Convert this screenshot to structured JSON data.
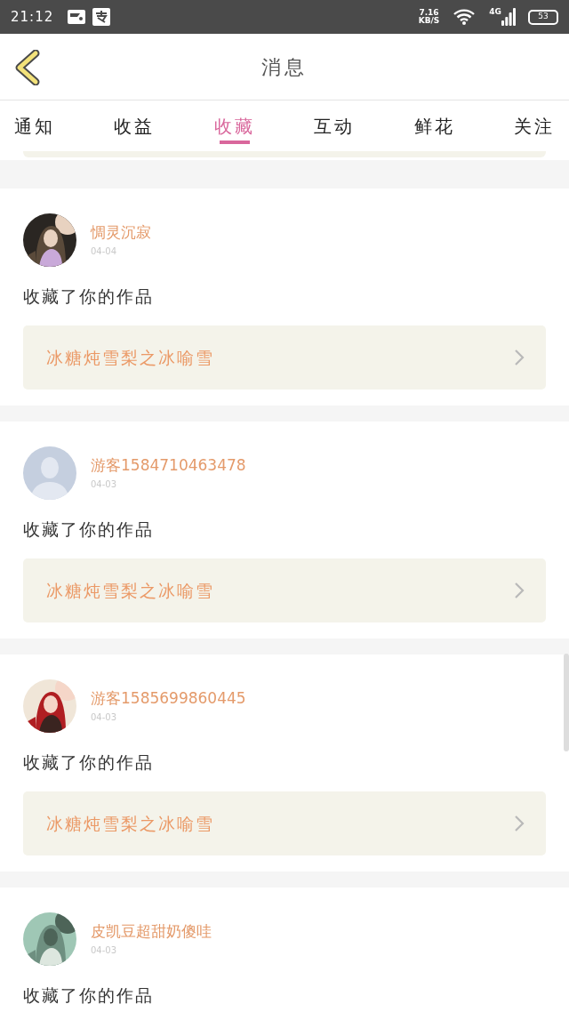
{
  "status_bar": {
    "time": "21:12",
    "speed": "7.16",
    "speed_unit": "KB/S",
    "network": "4G",
    "battery": "53"
  },
  "header": {
    "title": "消息"
  },
  "tabs": [
    {
      "label": "通知",
      "selected": false
    },
    {
      "label": "收益",
      "selected": false
    },
    {
      "label": "收藏",
      "selected": true
    },
    {
      "label": "互动",
      "selected": false
    },
    {
      "label": "鲜花",
      "selected": false
    },
    {
      "label": "关注",
      "selected": false
    }
  ],
  "items": [
    {
      "name": "惆灵沉寂",
      "date": "04-04",
      "action": "收藏了你的作品",
      "work": "冰糖炖雪梨之冰喻雪"
    },
    {
      "kind": "default",
      "name": "游客1584710463478",
      "date": "04-03",
      "action": "收藏了你的作品",
      "work": "冰糖炖雪梨之冰喻雪"
    },
    {
      "name": "游客1585699860445",
      "date": "04-03",
      "action": "收藏了你的作品",
      "work": "冰糖炖雪梨之冰喻雪"
    },
    {
      "name": "皮凯豆超甜奶傻哇",
      "date": "04-03",
      "action": "收藏了你的作品"
    }
  ]
}
